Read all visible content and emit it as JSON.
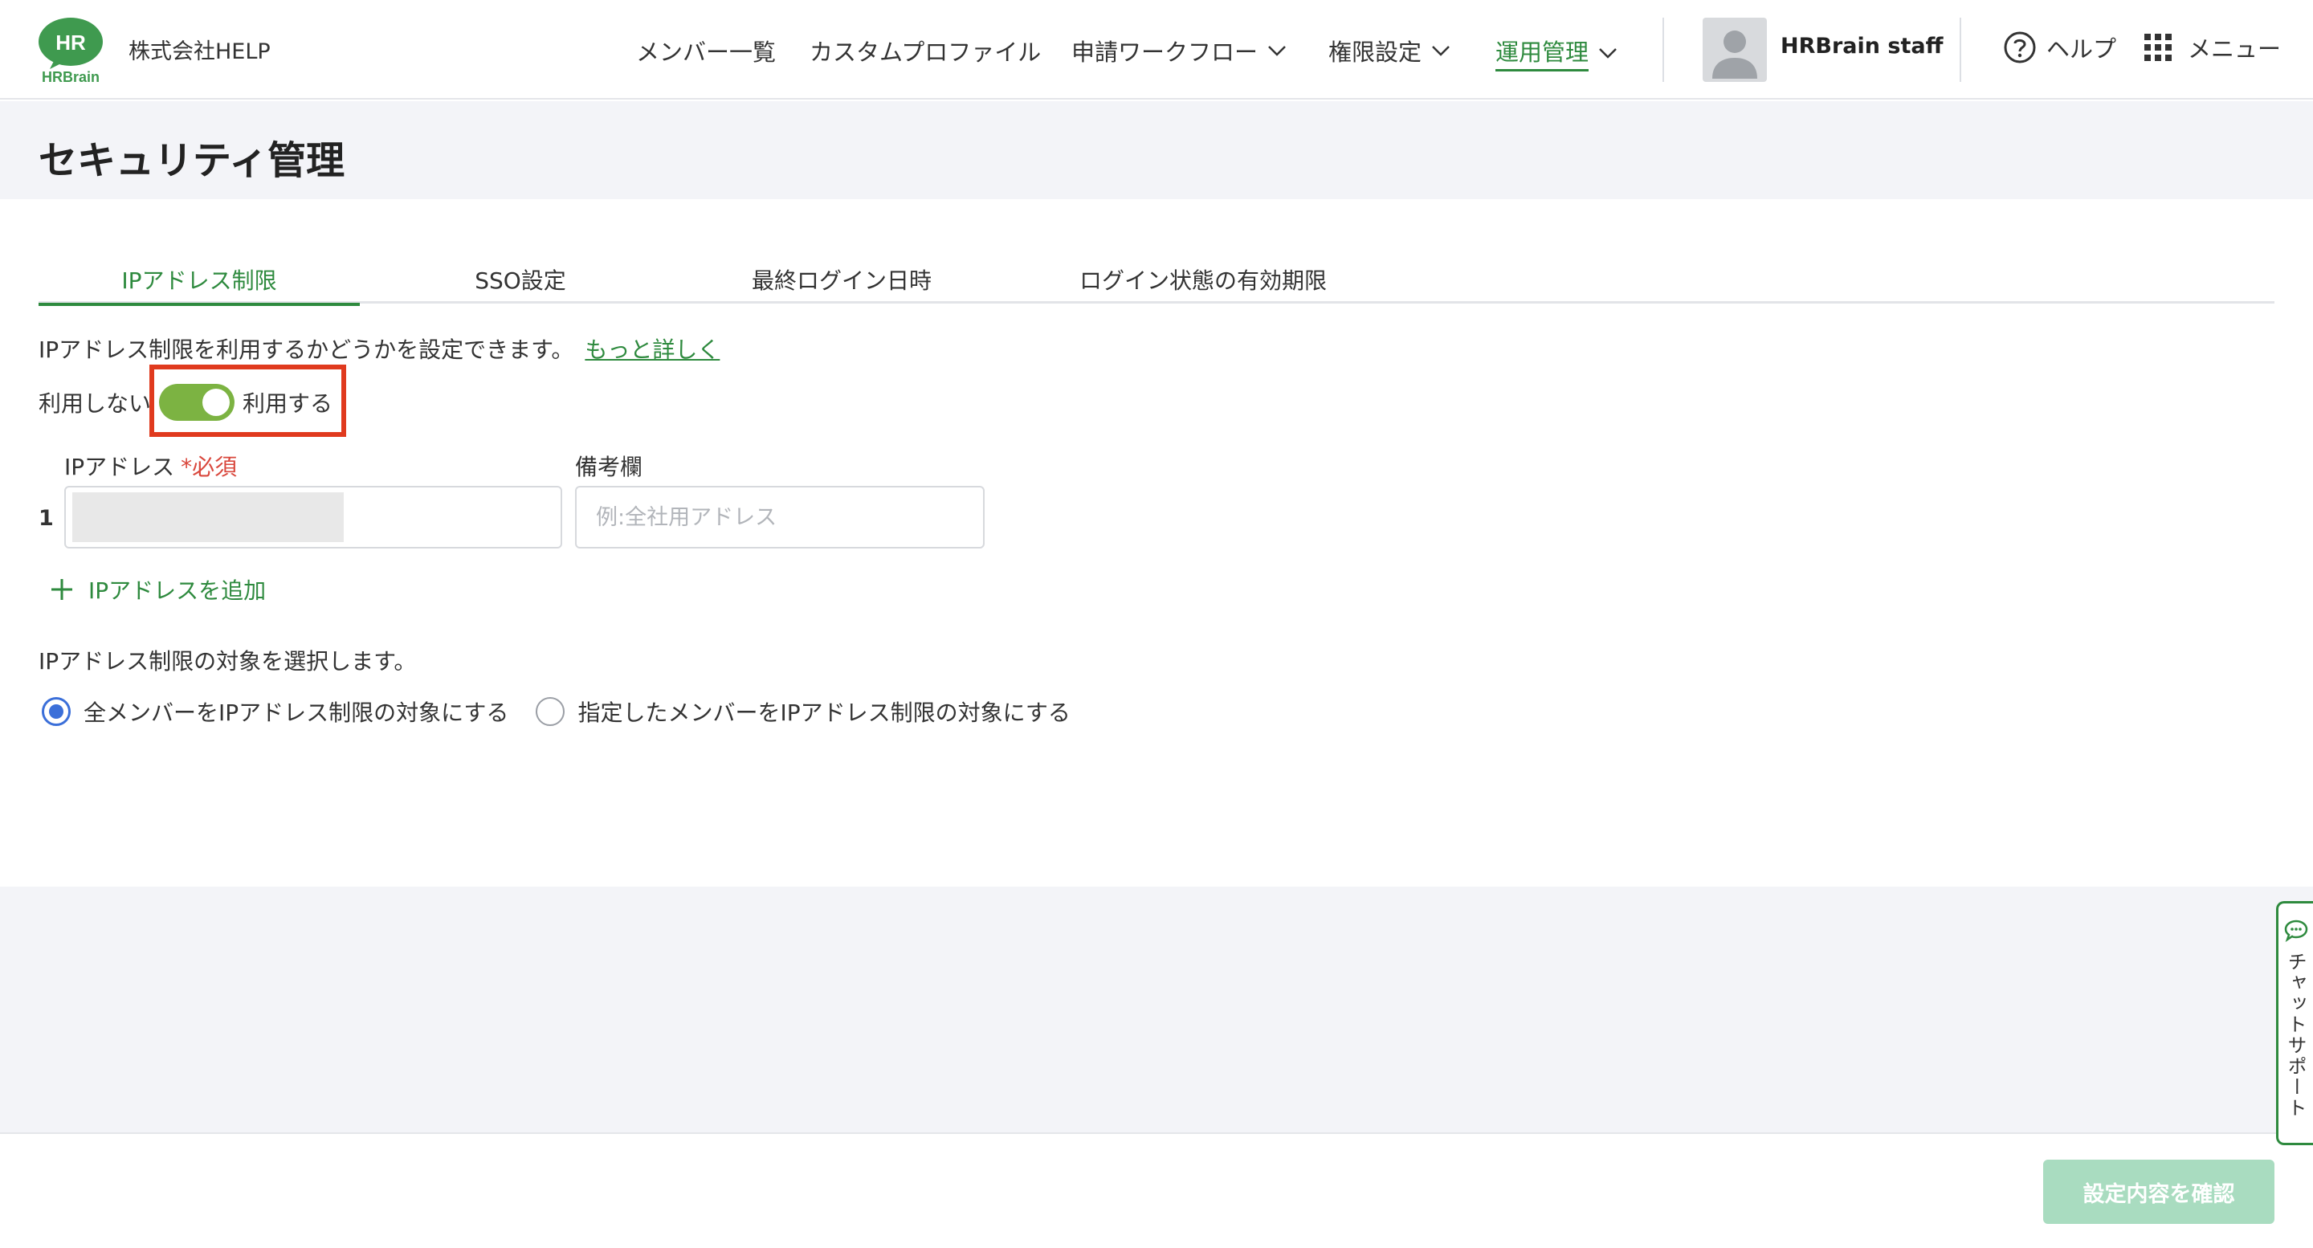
{
  "header": {
    "logo_top": "HR",
    "logo_bottom": "HRBrain",
    "company": "株式会社HELP",
    "nav": [
      {
        "label": "メンバー一覧"
      },
      {
        "label": "カスタムプロファイル"
      },
      {
        "label": "申請ワークフロー"
      },
      {
        "label": "権限設定"
      },
      {
        "label": "運用管理"
      }
    ],
    "username": "HRBrain staff",
    "help_label": "ヘルプ",
    "menu_label": "メニュー"
  },
  "page": {
    "title": "セキュリティ管理"
  },
  "tabs": [
    {
      "label": "IPアドレス制限"
    },
    {
      "label": "SSO設定"
    },
    {
      "label": "最終ログイン日時"
    },
    {
      "label": "ログイン状態の有効期限"
    }
  ],
  "ip_restriction": {
    "description": "IPアドレス制限を利用するかどうかを設定できます。",
    "learn_more": "もっと詳しく",
    "toggle_off_label": "利用しない",
    "toggle_on_label": "利用する",
    "toggle_on": true,
    "ip_label": "IPアドレス",
    "required_label": "*必須",
    "note_label": "備考欄",
    "row_index": "1",
    "note_placeholder": "例:全社用アドレス",
    "add_label": "IPアドレスを追加",
    "target_description": "IPアドレス制限の対象を選択します。",
    "radio_all": "全メンバーをIPアドレス制限の対象にする",
    "radio_selected": "指定したメンバーをIPアドレス制限の対象にする",
    "selected_option": "all"
  },
  "footer": {
    "confirm_label": "設定内容を確認"
  },
  "chat_support": {
    "label": "チャットサポート"
  },
  "colors": {
    "brand_green": "#2e8a3e",
    "toggle_green": "#7cb342",
    "highlight_red": "#e03a1e",
    "radio_blue": "#3b6fd9",
    "disabled_button": "#a9dcc0"
  }
}
